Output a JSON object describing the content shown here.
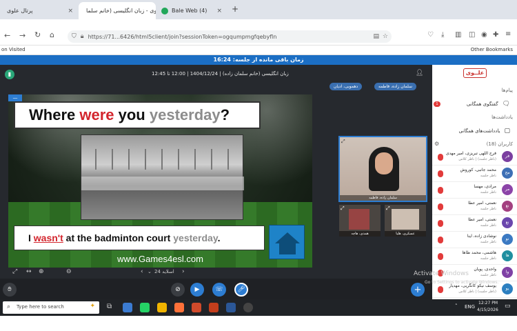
{
  "browser": {
    "tabs": [
      {
        "label": "پرتال علوی",
        "active": false
      },
      {
        "label": "علوی - زبان انگلیسی (خانم سلما...",
        "active": true
      },
      {
        "label": "Bale Web (4)",
        "active": false
      }
    ],
    "new_tab": "+",
    "url": "https://71...6426/html5client/join?sessionToken=ogqumpmgfqebyfln",
    "bookmarks_left": "on Visited",
    "bookmarks_right": "Other Bookmarks"
  },
  "session": {
    "timer_label": "زمان باقی مانده از جلسه: 16:24",
    "title": "زبان انگلیسی (خانم سلمان زاده) | 1404/12/24 | 12:00 تا 12:45",
    "chip_presenter": "سلمان زاده، فاطمه",
    "chip_second": "دهموبی، ادیان"
  },
  "slide": {
    "question_parts": [
      "Where ",
      "were",
      " you ",
      "yesterday",
      "?"
    ],
    "answer_parts": [
      "I ",
      "wasn't",
      " at the badminton court ",
      "yesterday",
      "."
    ],
    "site": "www.Games4esl.com",
    "page_label": "اسلاید 24"
  },
  "videos": {
    "main_label": "سلمان زاده، فاطمه",
    "tile1": "همدی، هاچه",
    "tile2": "عسکری، هلیا"
  },
  "sidebar": {
    "brand": "علــوی",
    "messages_head": "پیام‌ها",
    "chat_label": "گفتگوی همگانی",
    "chat_badge": "1",
    "notes_head": "یادداشت‌ها",
    "notes_label": "یادداشت‌های همگانی",
    "users_head": "کاربران (18)",
    "users": [
      {
        "initial": "فر",
        "name": "فرج اللهی تبریزی، امیر مهدی",
        "status": "(ناظر جلسه) | ناظر کلاس",
        "color": "#7b3fa0"
      },
      {
        "initial": "مح",
        "name": "محمد جانبی، کوروش",
        "status": "ناظر جلسه",
        "color": "#3d6fb5"
      },
      {
        "initial": "مر",
        "name": "مرادی، مهسا",
        "status": "ناظر جلسه",
        "color": "#8c44a8"
      },
      {
        "initial": "نع",
        "name": "نعمتی، امیر عطا",
        "status": "ناظر جلسه",
        "color": "#a34080"
      },
      {
        "initial": "نع",
        "name": "نعمتی، امیر عطا",
        "status": "ناظر جلسه",
        "color": "#6a46ad"
      },
      {
        "initial": "نو",
        "name": "نوشادی زاده، اینا",
        "status": "ناظر جلسه",
        "color": "#3b79c2"
      },
      {
        "initial": "ها",
        "name": "هاشمی، محمد طاها",
        "status": "ناظر جلسه",
        "color": "#1f8fa0"
      },
      {
        "initial": "وا",
        "name": "واحدی، پویان",
        "status": "ناظر جلسه",
        "color": "#7f41a5"
      },
      {
        "initial": "یو",
        "name": "یوسف نیکو کانگریی، مهدیار",
        "status": "(ناظر جلسه) | ناظر کلاس",
        "color": "#2c7fc0"
      }
    ]
  },
  "os": {
    "watermark_title": "Activate Windows",
    "watermark_sub": "Go to Settings to activate Windows.",
    "search_placeholder": "Type here to search",
    "time": "12:27 PM",
    "date": "4/15/2026",
    "lang": "ENG"
  }
}
